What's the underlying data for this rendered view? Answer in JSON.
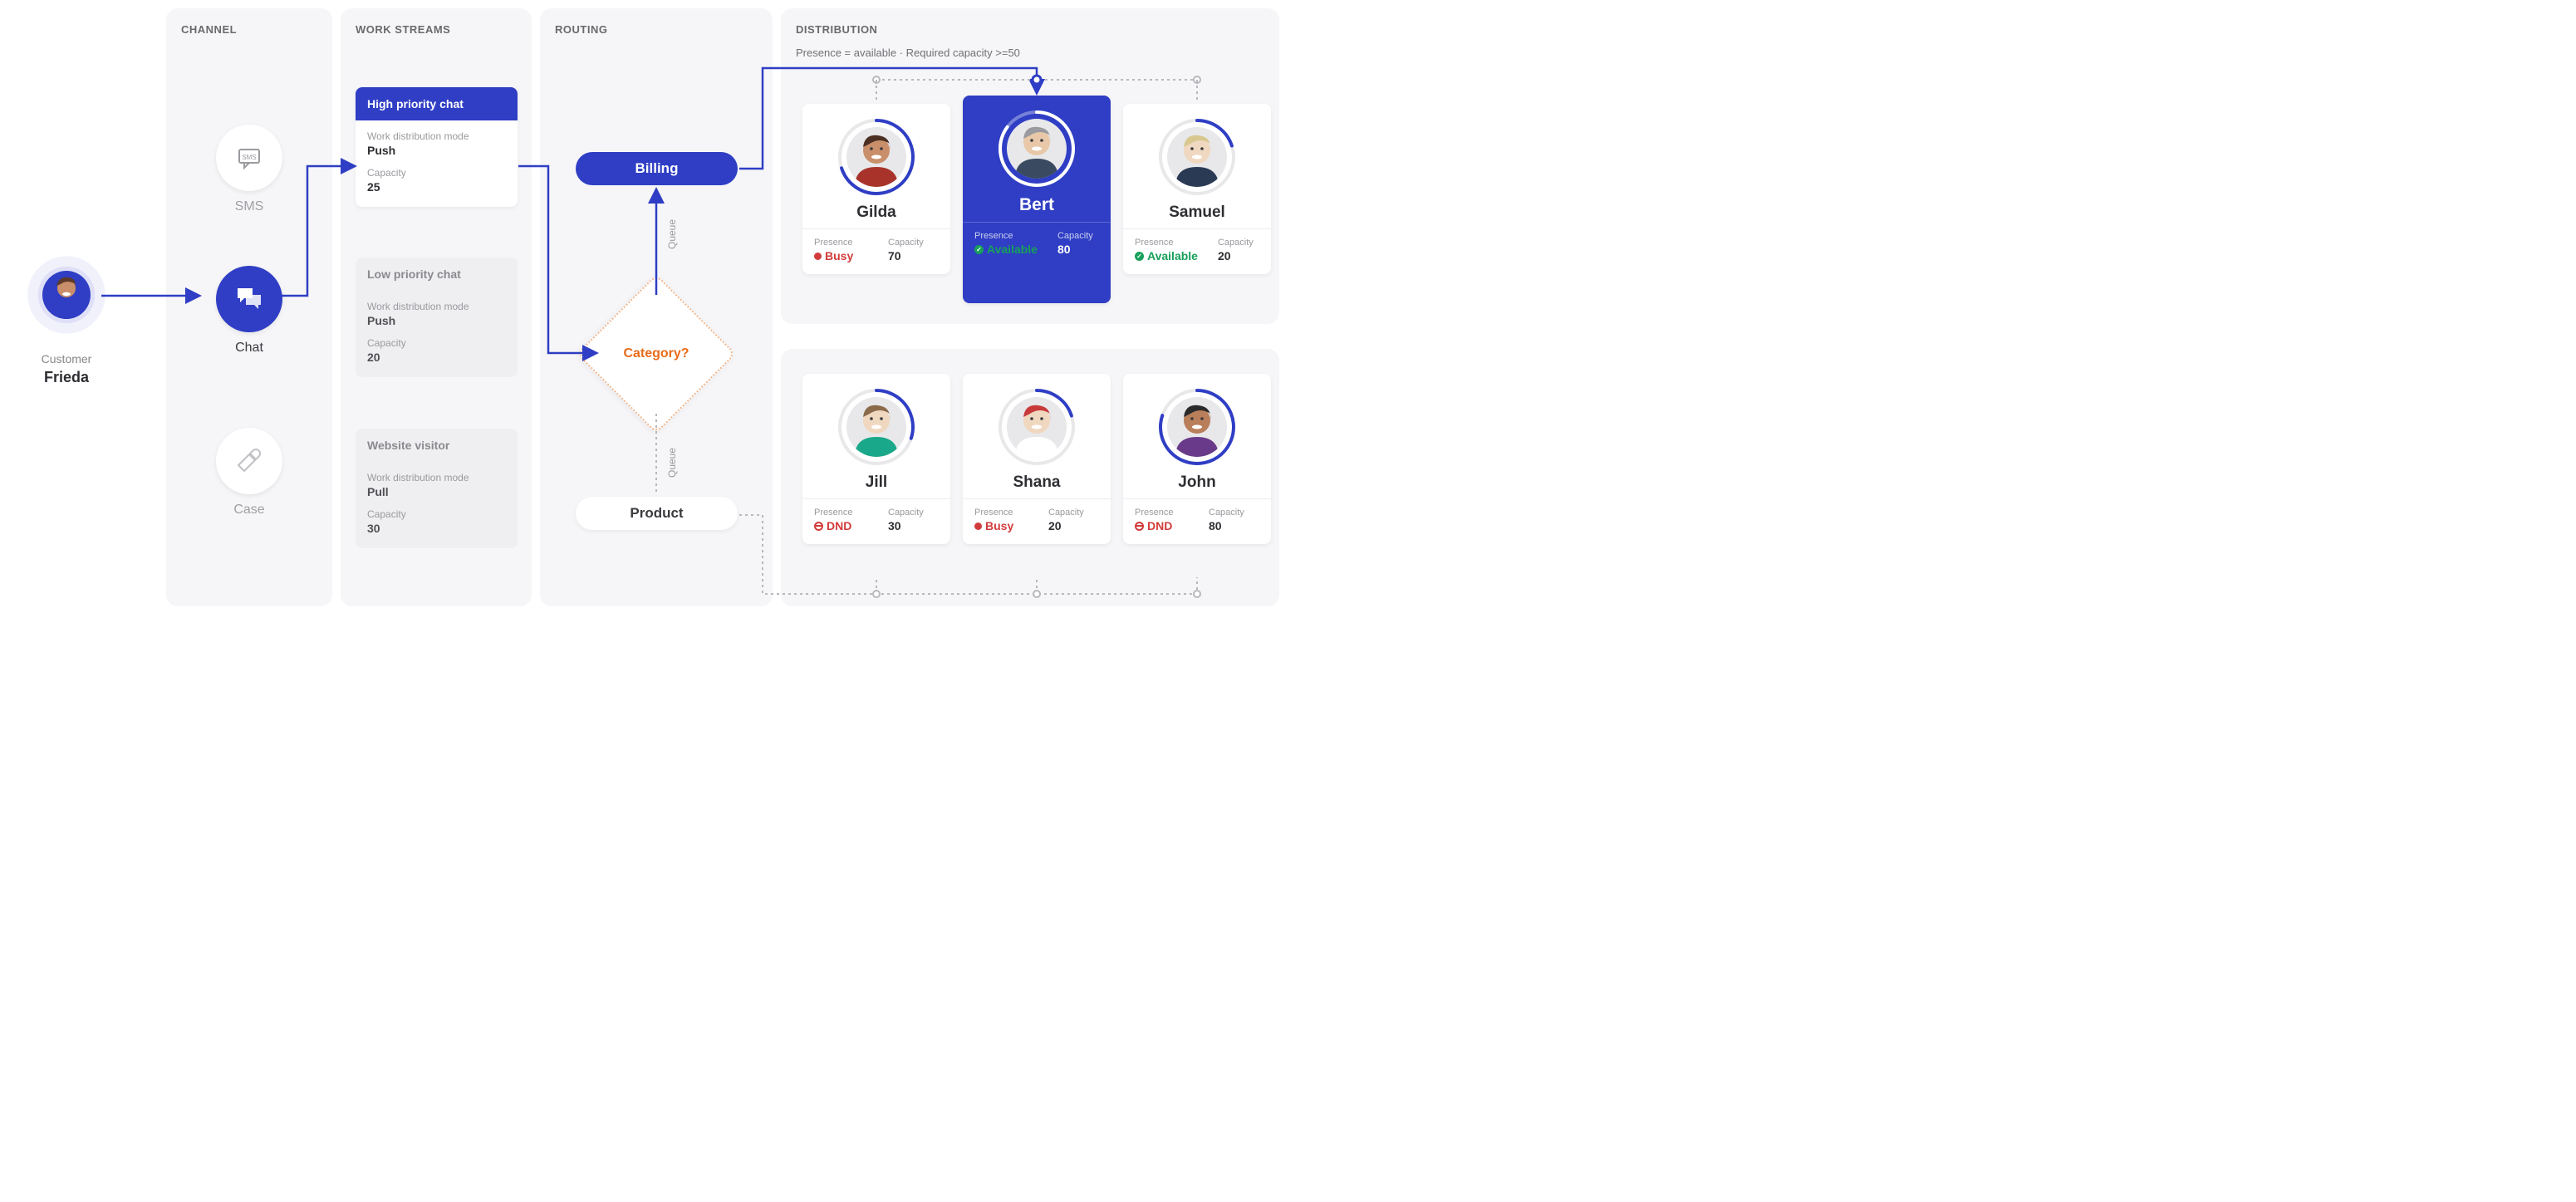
{
  "columns": {
    "channel": "CHANNEL",
    "work_streams": "WORK STREAMS",
    "routing": "ROUTING",
    "distribution": "DISTRIBUTION"
  },
  "distribution_rule": "Presence = available  ·  Required capacity >=50",
  "customer": {
    "label": "Customer",
    "name": "Frieda"
  },
  "channels": {
    "sms": {
      "label": "SMS"
    },
    "chat": {
      "label": "Chat"
    },
    "case": {
      "label": "Case"
    }
  },
  "work_streams": [
    {
      "title": "High priority chat",
      "mode_label": "Work distribution mode",
      "mode": "Push",
      "cap_label": "Capacity",
      "cap": "25",
      "active": true
    },
    {
      "title": "Low priority chat",
      "mode_label": "Work distribution mode",
      "mode": "Push",
      "cap_label": "Capacity",
      "cap": "20",
      "active": false
    },
    {
      "title": "Website visitor",
      "mode_label": "Work distribution mode",
      "mode": "Pull",
      "cap_label": "Capacity",
      "cap": "30",
      "active": false
    }
  ],
  "routing": {
    "billing": "Billing",
    "category": "Category?",
    "product": "Product",
    "queue_label": "Queue"
  },
  "agents": {
    "labels": {
      "presence": "Presence",
      "capacity": "Capacity"
    },
    "top": [
      {
        "name": "Gilda",
        "presence": "Busy",
        "presence_kind": "busy",
        "capacity": "70",
        "ring_pct": 70,
        "selected": false
      },
      {
        "name": "Bert",
        "presence": "Available",
        "presence_kind": "available",
        "capacity": "80",
        "ring_pct": 85,
        "selected": true
      },
      {
        "name": "Samuel",
        "presence": "Available",
        "presence_kind": "available",
        "capacity": "20",
        "ring_pct": 20,
        "selected": false
      }
    ],
    "bottom": [
      {
        "name": "Jill",
        "presence": "DND",
        "presence_kind": "dnd",
        "capacity": "30",
        "ring_pct": 30
      },
      {
        "name": "Shana",
        "presence": "Busy",
        "presence_kind": "busy",
        "capacity": "20",
        "ring_pct": 20
      },
      {
        "name": "John",
        "presence": "DND",
        "presence_kind": "dnd",
        "capacity": "80",
        "ring_pct": 80
      }
    ]
  },
  "colors": {
    "primary": "#2f3ec4",
    "orange": "#e86b1a",
    "green": "#17a05a",
    "red": "#d23b3b",
    "col_bg": "#f6f6f8"
  }
}
